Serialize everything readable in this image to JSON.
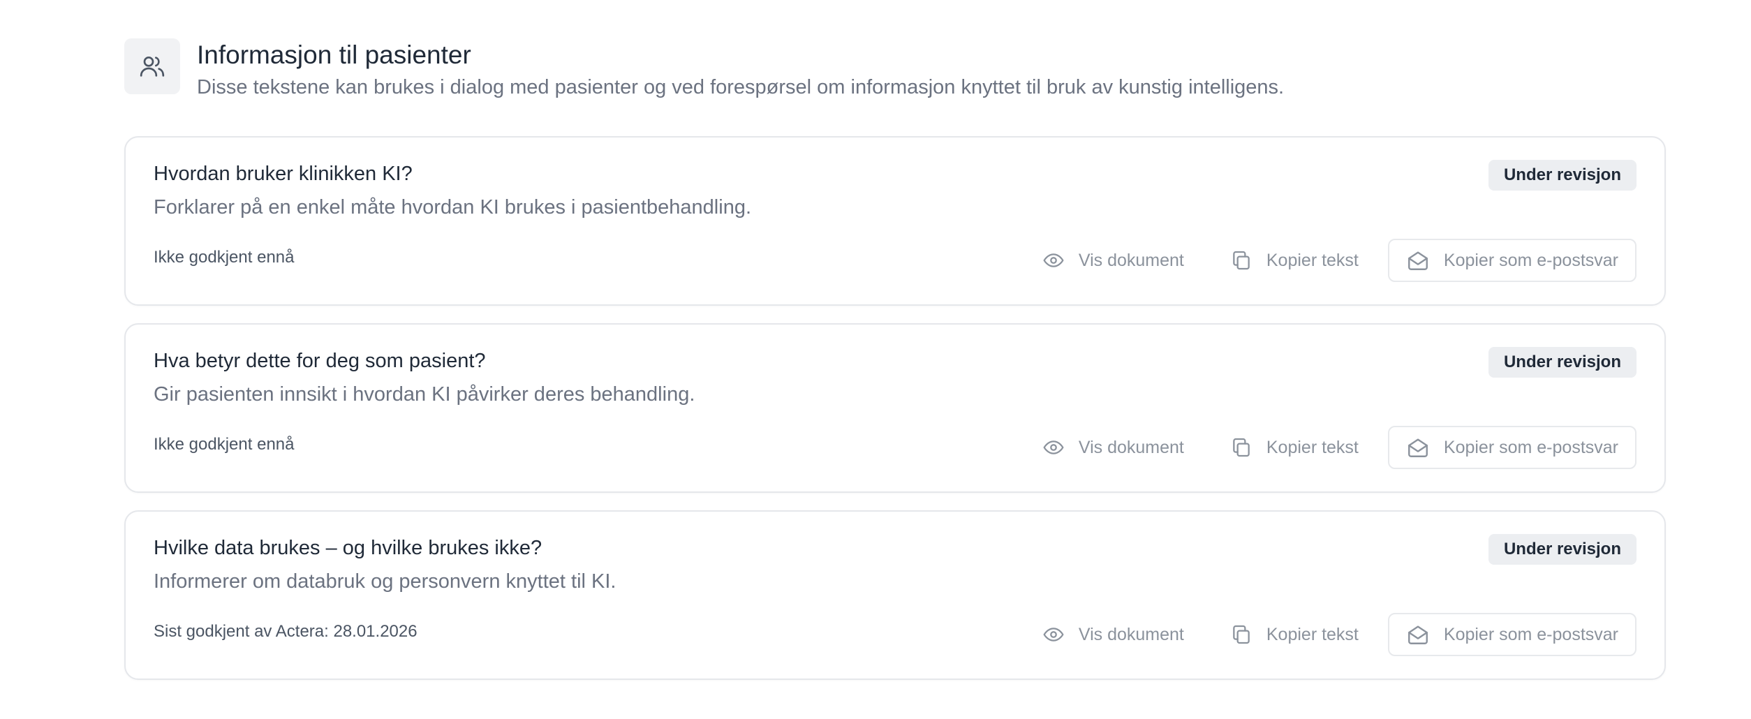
{
  "header": {
    "icon": "users-icon",
    "title": "Informasjon til pasienter",
    "subtitle": "Disse tekstene kan brukes i dialog med pasienter og ved forespørsel om informasjon knyttet til bruk av kunstig intelligens."
  },
  "colors": {
    "badge_bg": "#eceef1",
    "muted_text": "#6b7280",
    "action_text": "#8b929c",
    "border": "#e5e7eb"
  },
  "cards": [
    {
      "title": "Hvordan bruker klinikken KI?",
      "description": "Forklarer på en enkel måte hvordan KI brukes i pasientbehandling.",
      "badge": "Under revisjon",
      "approval": "Ikke godkjent ennå",
      "actions": {
        "view": "Vis dokument",
        "view_icon": "eye-icon",
        "copy": "Kopier tekst",
        "copy_icon": "copy-icon",
        "email": "Kopier som e-postsvar",
        "email_icon": "mail-open-icon"
      }
    },
    {
      "title": "Hva betyr dette for deg som pasient?",
      "description": "Gir pasienten innsikt i hvordan KI påvirker deres behandling.",
      "badge": "Under revisjon",
      "approval": "Ikke godkjent ennå",
      "actions": {
        "view": "Vis dokument",
        "view_icon": "eye-icon",
        "copy": "Kopier tekst",
        "copy_icon": "copy-icon",
        "email": "Kopier som e-postsvar",
        "email_icon": "mail-open-icon"
      }
    },
    {
      "title": "Hvilke data brukes – og hvilke brukes ikke?",
      "description": "Informerer om databruk og personvern knyttet til KI.",
      "badge": "Under revisjon",
      "approval": "Sist godkjent av Actera: 28.01.2026",
      "actions": {
        "view": "Vis dokument",
        "view_icon": "eye-icon",
        "copy": "Kopier tekst",
        "copy_icon": "copy-icon",
        "email": "Kopier som e-postsvar",
        "email_icon": "mail-open-icon"
      }
    }
  ]
}
